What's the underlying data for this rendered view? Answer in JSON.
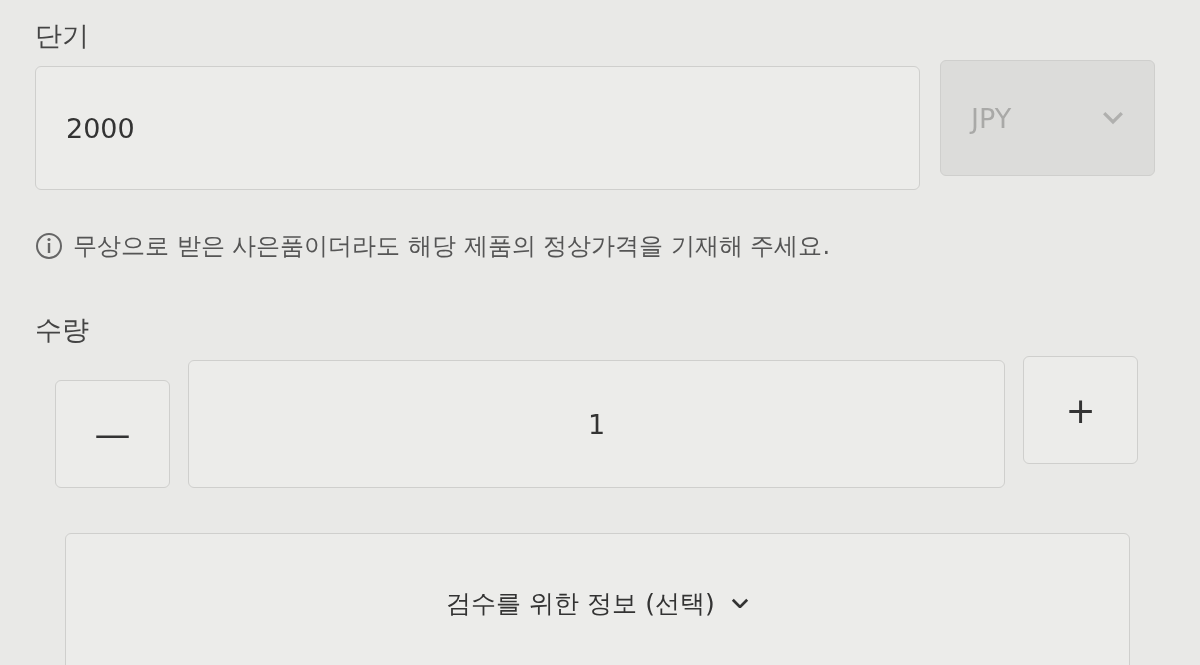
{
  "price": {
    "label": "단기",
    "value": "2000",
    "currency": {
      "value": "JPY",
      "disabled": true
    }
  },
  "note": {
    "text": "무상으로 받은 사은품이더라도 해당 제품의 정상가격을 기재해 주세요."
  },
  "quantity": {
    "label": "수량",
    "value": "1",
    "minus": "—",
    "plus": "+"
  },
  "accordion": {
    "label": "검수를 위한 정보 (선택)",
    "expanded": false
  }
}
